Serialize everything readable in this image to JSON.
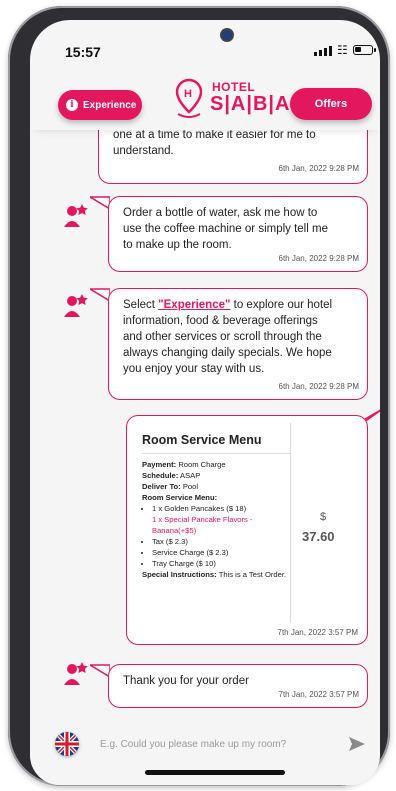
{
  "status_bar": {
    "time": "15:57"
  },
  "header": {
    "experience_label": "Experience",
    "offers_label": "Offers",
    "logo_top": "HOTEL",
    "logo_bottom": "S|A|B|A"
  },
  "messages": [
    {
      "text_lines": [
        "one at a time to make it easier for me to",
        "understand."
      ],
      "time": "6th Jan, 2022 9:28 PM"
    },
    {
      "text_lines": [
        "Order a bottle of water, ask me how to",
        "use the coffee machine or simply tell me",
        "to make up the room."
      ],
      "time": "6th Jan, 2022 9:28 PM"
    },
    {
      "prefix": "Select ",
      "link": "\"Experience\"",
      "text_lines_after": [
        " to explore our hotel",
        "information, food & beverage offerings",
        "and other services or scroll through the",
        "always changing daily specials. We hope",
        "you enjoy your stay with us."
      ],
      "time": "6th Jan, 2022 9:28 PM"
    }
  ],
  "room_service": {
    "title": "Room Service Menu",
    "payment_label": "Payment:",
    "payment_value": "Room Charge",
    "schedule_label": "Schedule:",
    "schedule_value": "ASAP",
    "deliver_label": "Deliver To:",
    "deliver_value": "Pool",
    "menu_label": "Room Service Menu:",
    "items": [
      {
        "text": "1 x Golden Pancakes   ($ 18)",
        "sub": "1 x Special Pancake Flavors - Banana(+$5)"
      },
      {
        "text": "Tax ($ 2.3)"
      },
      {
        "text": "Service Charge ($ 2.3)"
      },
      {
        "text": "Tray Charge ($ 10)"
      }
    ],
    "special_label": "Special Instructions:",
    "special_value": "This is a Test Order.",
    "currency": "$",
    "total": "37.60",
    "time": "7th Jan, 2022 3:57 PM"
  },
  "final_message": {
    "text": "Thank you for your order",
    "time": "7th Jan, 2022 3:57 PM"
  },
  "composer": {
    "placeholder": "E.g. Could you please make up my room?"
  },
  "colors": {
    "accent": "#e2175e",
    "background": "#f5f5f6"
  }
}
